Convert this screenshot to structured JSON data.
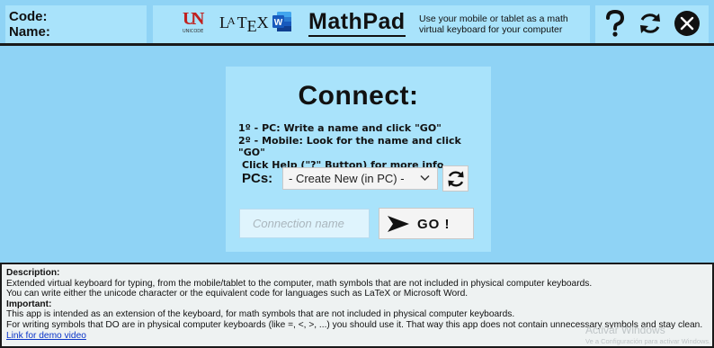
{
  "header": {
    "code_label": "Code:",
    "name_label": "Name:",
    "logos": {
      "unicode_mark": "U",
      "unicode_text": "UNICODE",
      "latex": "LATEX",
      "word": "W"
    },
    "app_title": "MathPad",
    "tagline": "Use your mobile or tablet as a math virtual keyboard for your computer",
    "actions": [
      "help-icon",
      "refresh-icon",
      "close-icon"
    ]
  },
  "connect": {
    "title": "Connect:",
    "step1": "1º - PC: Write a name and click \"GO\"",
    "step2": "2º - Mobile: Look for the name and click \"GO\"",
    "step3": "Click Help (\"?\" Button) for more info.",
    "pcs_label": "PCs:",
    "pcs_selected": "- Create New (in PC) -",
    "connection_placeholder": "Connection name",
    "go_label": "GO !"
  },
  "description": {
    "heading": "Description:",
    "line1": "Extended virtual keyboard for typing, from the mobile/tablet to the computer, math symbols that are not included in physical computer keyboards.",
    "line2": "You can write either the unicode character or the equivalent code for languages such as LaTeX or Microsoft Word.",
    "important_heading": "Important:",
    "line3": "This app is intended as an extension of the keyboard, for math symbols that are not included in physical computer keyboards.",
    "line4": "For writing symbols that DO are in physical computer keyboards (like =, <, >, ...) you should use it. That way this app does not contain unnecessary symbols and stay clean.",
    "link_text": "Link for demo video"
  },
  "watermark": {
    "line1": "Activar Windows",
    "line2": "Ve a Configuración para activar Windows."
  },
  "colors": {
    "background": "#8fd3f5",
    "panel": "#a9e3fb",
    "unicode_red": "#c0221f",
    "word_blue": "#2b579a"
  }
}
